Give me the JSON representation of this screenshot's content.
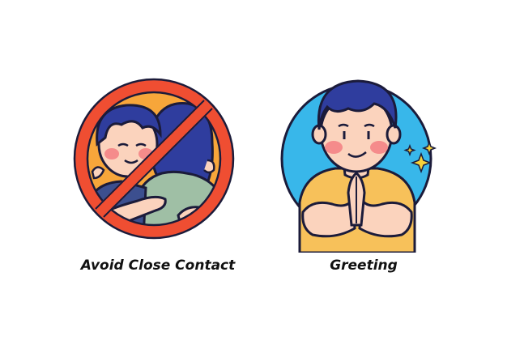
{
  "captions": {
    "left": "Avoid Close Contact",
    "right": "Greeting"
  },
  "illustrations": {
    "left": {
      "icon": "no-hugging-icon",
      "colors": {
        "background": "#f7a63a",
        "ring": "#ef4e32",
        "hair": "#2f3d9e",
        "skin": "#fbd3bd",
        "shirt": "#9fbfa5",
        "outline": "#1b1b3a"
      }
    },
    "right": {
      "icon": "greeting-person-icon",
      "colors": {
        "background": "#38b7ea",
        "ring": "#1b1b3a",
        "hair": "#2f3d9e",
        "skin": "#fbd3bd",
        "shirt": "#f7c15a",
        "sparkle": "#f6d23a"
      }
    }
  }
}
